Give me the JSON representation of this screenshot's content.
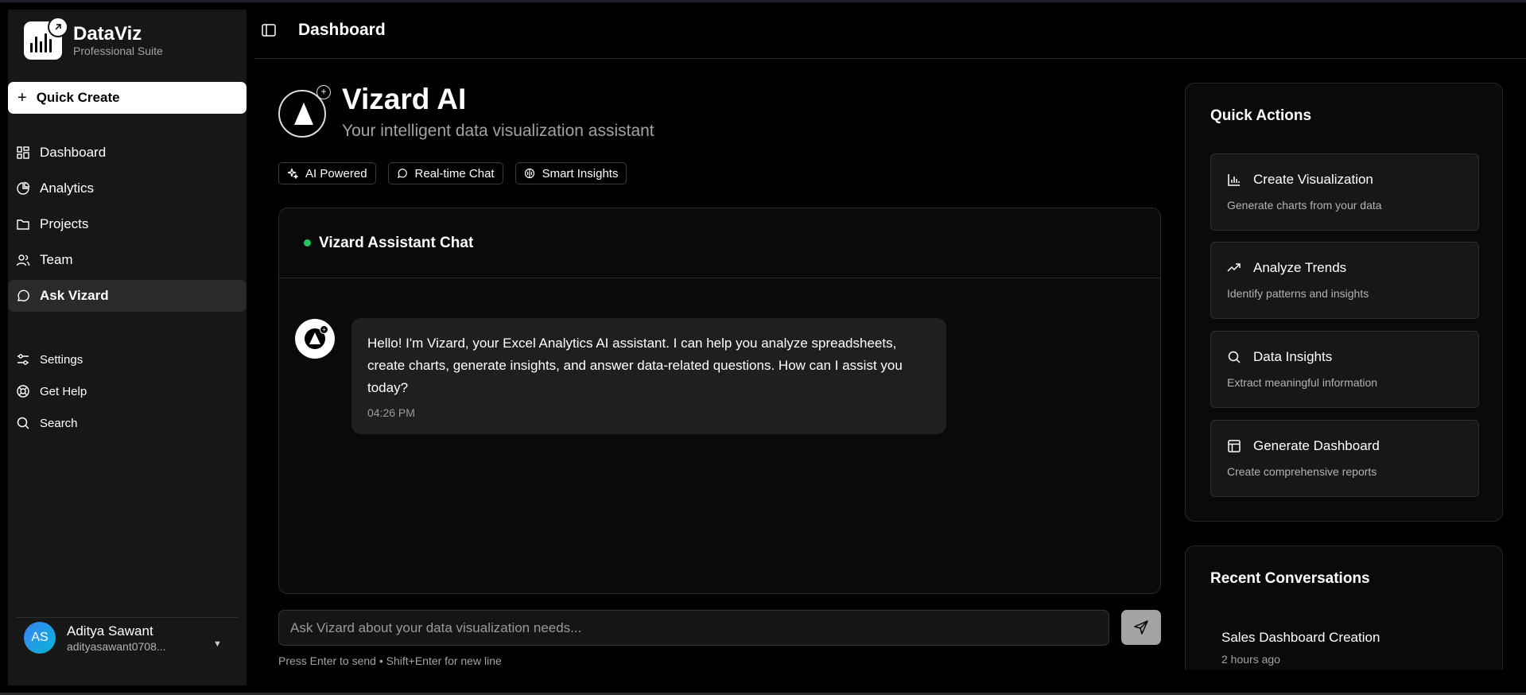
{
  "brand": {
    "title": "DataViz",
    "subtitle": "Professional Suite"
  },
  "sidebar": {
    "quick_create": "Quick Create",
    "items": [
      {
        "label": "Dashboard",
        "icon": "dashboard-icon"
      },
      {
        "label": "Analytics",
        "icon": "pie-chart-icon"
      },
      {
        "label": "Projects",
        "icon": "folder-icon"
      },
      {
        "label": "Team",
        "icon": "users-icon"
      },
      {
        "label": "Ask Vizard",
        "icon": "chat-icon",
        "active": true
      }
    ],
    "secondary": [
      {
        "label": "Settings",
        "icon": "settings-icon"
      },
      {
        "label": "Get Help",
        "icon": "help-icon"
      },
      {
        "label": "Search",
        "icon": "search-icon"
      }
    ],
    "user": {
      "initials": "AS",
      "name": "Aditya Sawant",
      "email": "adityasawant0708..."
    }
  },
  "header": {
    "title": "Dashboard"
  },
  "hero": {
    "title": "Vizard AI",
    "subtitle": "Your intelligent data visualization assistant",
    "chips": [
      "AI Powered",
      "Real-time Chat",
      "Smart Insights"
    ]
  },
  "chat": {
    "title": "Vizard Assistant Chat",
    "messages": [
      {
        "text": "Hello! I'm Vizard, your Excel Analytics AI assistant. I can help you analyze spreadsheets, create charts, generate insights, and answer data-related questions. How can I assist you today?",
        "time": "04:26 PM"
      }
    ],
    "input_placeholder": "Ask Vizard about your data visualization needs...",
    "hint": "Press Enter to send • Shift+Enter for new line"
  },
  "quick_actions": {
    "title": "Quick Actions",
    "items": [
      {
        "title": "Create Visualization",
        "desc": "Generate charts from your data",
        "icon": "bar-chart-icon"
      },
      {
        "title": "Analyze Trends",
        "desc": "Identify patterns and insights",
        "icon": "trending-up-icon"
      },
      {
        "title": "Data Insights",
        "desc": "Extract meaningful information",
        "icon": "search-icon"
      },
      {
        "title": "Generate Dashboard",
        "desc": "Create comprehensive reports",
        "icon": "layout-icon"
      }
    ]
  },
  "recent": {
    "title": "Recent Conversations",
    "items": [
      {
        "title": "Sales Dashboard Creation",
        "time": "2 hours ago"
      }
    ]
  },
  "colors": {
    "accent_green": "#22c55e",
    "background": "#000000",
    "panel": "#171717"
  }
}
